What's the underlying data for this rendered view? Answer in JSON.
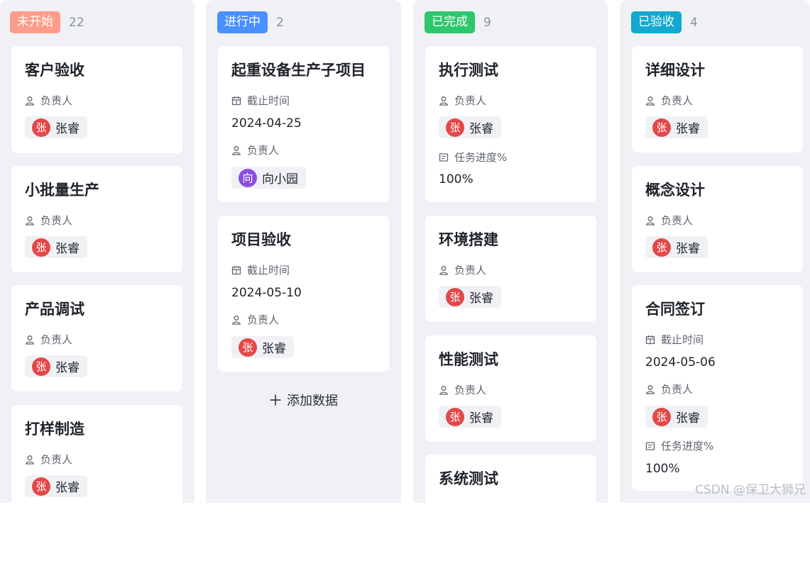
{
  "labels": {
    "owner": "负责人",
    "deadline": "截止时间",
    "progress": "任务进度%"
  },
  "columns": [
    {
      "status": "未开始",
      "count": "22",
      "color": "#fe9c8a",
      "cards": [
        {
          "title": "客户验收",
          "owner": "张睿",
          "avatar": "张"
        },
        {
          "title": "小批量生产",
          "owner": "张睿",
          "avatar": "张"
        },
        {
          "title": "产品调试",
          "owner": "张睿",
          "avatar": "张"
        },
        {
          "title": "打样制造",
          "owner": "张睿",
          "avatar": "张"
        }
      ]
    },
    {
      "status": "进行中",
      "count": "2",
      "color": "#4a8ffe",
      "cards": [
        {
          "title": "起重设备生产子项目",
          "deadline": "2024-04-25",
          "owner": "向小园",
          "avatar": "向"
        },
        {
          "title": "项目验收",
          "deadline": "2024-05-10",
          "owner": "张睿",
          "avatar": "张"
        }
      ],
      "add_label": "添加数据"
    },
    {
      "status": "已完成",
      "count": "9",
      "color": "#2dc76d",
      "cards": [
        {
          "title": "执行测试",
          "owner": "张睿",
          "avatar": "张",
          "progress": "100%"
        },
        {
          "title": "环境搭建",
          "owner": "张睿",
          "avatar": "张"
        },
        {
          "title": "性能测试",
          "owner": "张睿",
          "avatar": "张"
        },
        {
          "title": "系统测试"
        }
      ]
    },
    {
      "status": "已验收",
      "count": "4",
      "color": "#12a8cf",
      "cards": [
        {
          "title": "详细设计",
          "owner": "张睿",
          "avatar": "张"
        },
        {
          "title": "概念设计",
          "owner": "张睿",
          "avatar": "张"
        },
        {
          "title": "合同签订",
          "deadline": "2024-05-06",
          "owner": "张睿",
          "avatar": "张",
          "progress": "100%"
        }
      ]
    }
  ],
  "avatar_colors": {
    "张": "#e34848",
    "向": "#8a4fe0"
  },
  "watermark": "CSDN @保卫大狮兄"
}
